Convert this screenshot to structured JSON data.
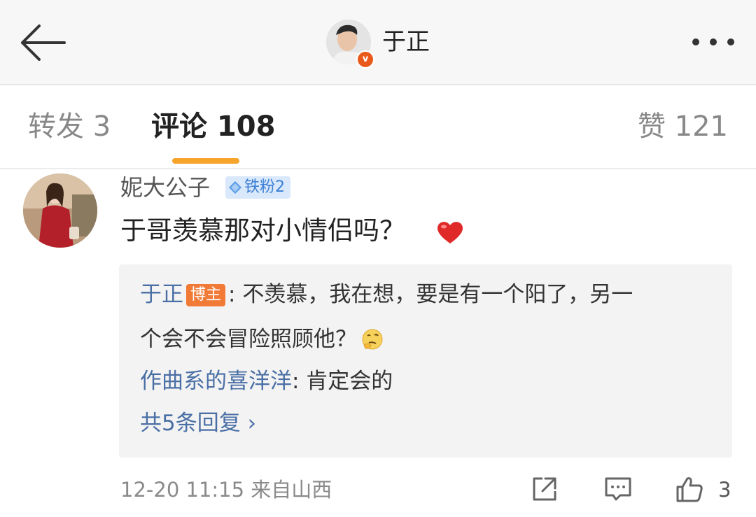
{
  "header": {
    "title": "于正",
    "verified_mark": "v"
  },
  "tabs": {
    "repost": "转发 3",
    "comment": "评论 108",
    "like": "赞 121"
  },
  "comment": {
    "username": "妮大公子",
    "fan_badge": "铁粉2",
    "text": "于哥羡慕那对小情侣吗？",
    "replies": [
      {
        "name": "于正",
        "badge": "博主",
        "text_line1": ": 不羡慕，我在想，要是有一个阳了，另一",
        "text_line2": "个会不会冒险照顾他？"
      },
      {
        "name": "作曲系的喜洋洋",
        "text": ": 肯定会的"
      }
    ],
    "more_replies": "共5条回复 ›",
    "meta": "12-20 11:15  来自山西",
    "like_count": "3"
  },
  "colors": {
    "accent": "#f7a52a",
    "link": "#4a6fa5",
    "blogger_badge": "#f07a36"
  }
}
